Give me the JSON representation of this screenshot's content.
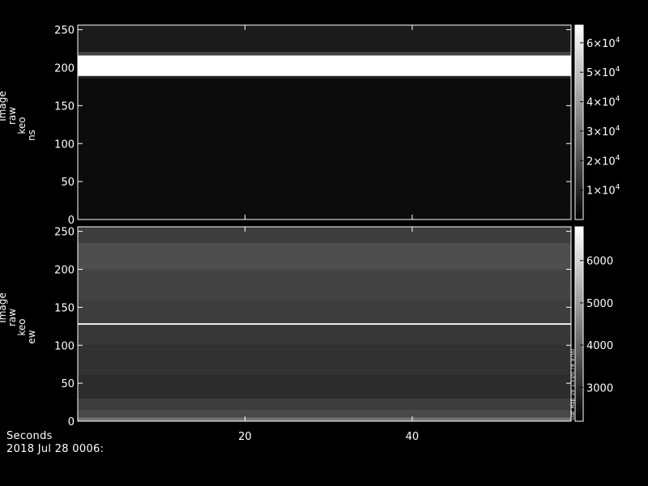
{
  "chart_data": [
    {
      "type": "heatmap",
      "ylabel_lines": [
        "Image",
        "raw",
        "keo",
        "ns"
      ],
      "yticks": [
        0,
        50,
        100,
        150,
        200,
        250
      ],
      "ylim": [
        0,
        256
      ],
      "xlim": [
        0,
        59
      ],
      "grayscale_min": 0,
      "grayscale_max": 65535,
      "colorbar_ticks": [
        10000,
        20000,
        30000,
        40000,
        50000,
        60000
      ],
      "colorbar_labels": [
        {
          "mantissa": "1×10",
          "exp": "4"
        },
        {
          "mantissa": "2×10",
          "exp": "4"
        },
        {
          "mantissa": "3×10",
          "exp": "4"
        },
        {
          "mantissa": "4×10",
          "exp": "4"
        },
        {
          "mantissa": "5×10",
          "exp": "4"
        },
        {
          "mantissa": "6×10",
          "exp": "4"
        }
      ],
      "colorbar_range": [
        0,
        66000
      ],
      "bands": [
        {
          "y0": 0,
          "y1": 186,
          "value": 3000
        },
        {
          "y0": 186,
          "y1": 189,
          "value": 9000
        },
        {
          "y0": 189,
          "y1": 216,
          "value": 65535
        },
        {
          "y0": 216,
          "y1": 221,
          "value": 17000
        },
        {
          "y0": 221,
          "y1": 256,
          "value": 7000
        }
      ]
    },
    {
      "type": "heatmap",
      "ylabel_lines": [
        "Image",
        "raw",
        "keo",
        "ew"
      ],
      "yticks": [
        0,
        50,
        100,
        150,
        200,
        250
      ],
      "ylim": [
        0,
        256
      ],
      "xlim": [
        0,
        59
      ],
      "grayscale_min": 2200,
      "grayscale_max": 6800,
      "colorbar_ticks": [
        3000,
        4000,
        5000,
        6000
      ],
      "colorbar_labels": [
        {
          "mantissa": "3000",
          "exp": ""
        },
        {
          "mantissa": "4000",
          "exp": ""
        },
        {
          "mantissa": "5000",
          "exp": ""
        },
        {
          "mantissa": "6000",
          "exp": ""
        }
      ],
      "colorbar_range": [
        2200,
        6800
      ],
      "colorbar_note": "Dat_Map_19_1.53/0.7A_8700",
      "bands": [
        {
          "y0": 0,
          "y1": 5,
          "value": 4300
        },
        {
          "y0": 5,
          "y1": 15,
          "value": 3500
        },
        {
          "y0": 15,
          "y1": 30,
          "value": 3300
        },
        {
          "y0": 30,
          "y1": 60,
          "value": 3000
        },
        {
          "y0": 60,
          "y1": 100,
          "value": 3100
        },
        {
          "y0": 100,
          "y1": 127,
          "value": 3200
        },
        {
          "y0": 127,
          "y1": 129,
          "value": 6800
        },
        {
          "y0": 129,
          "y1": 160,
          "value": 3300
        },
        {
          "y0": 160,
          "y1": 200,
          "value": 3400
        },
        {
          "y0": 200,
          "y1": 235,
          "value": 3600
        },
        {
          "y0": 235,
          "y1": 256,
          "value": 3300
        }
      ]
    }
  ],
  "x_axis": {
    "xticks": [
      20,
      40
    ],
    "xlim": [
      0,
      59
    ]
  },
  "footer": {
    "unit_label": "Seconds",
    "date_label": "2018 Jul 28 0006:"
  }
}
